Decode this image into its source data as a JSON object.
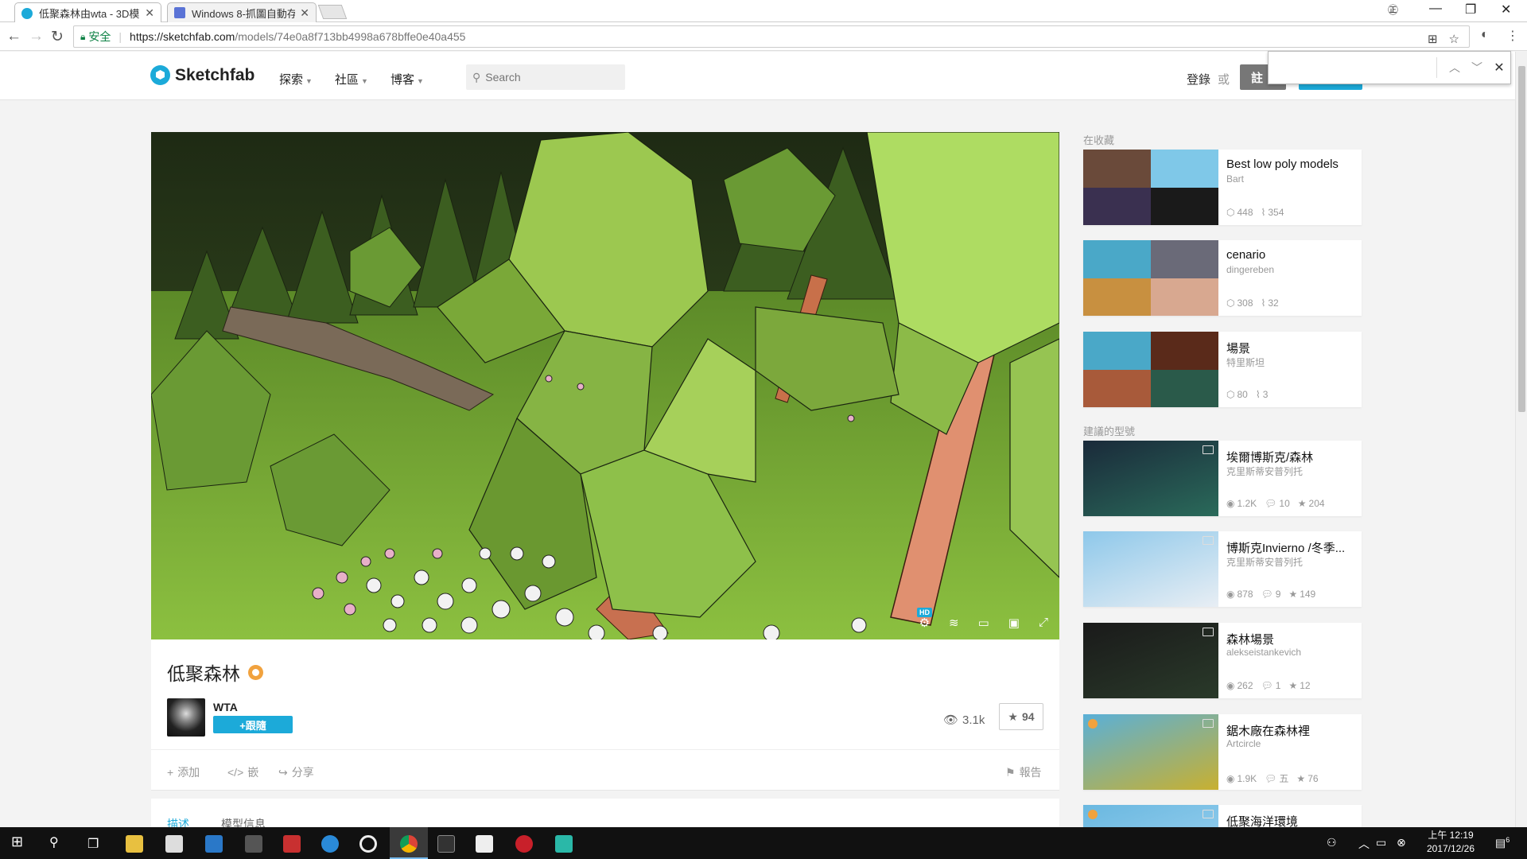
{
  "browser": {
    "tabs": [
      {
        "title": "低聚森林由wta - 3D模型",
        "active": true
      },
      {
        "title": "Windows 8-抓圖自動存",
        "active": false
      }
    ],
    "window_controls": {
      "translate": "㊣",
      "minimize": "—",
      "maximize": "❐",
      "close": "✕"
    },
    "security_label": "安全",
    "url_host": "https://sketchfab.com",
    "url_path": "/models/74e0a8f713bb4998a678bffe0e40a455",
    "find_placeholder": ""
  },
  "site": {
    "logo_text": "Sketchfab",
    "nav": [
      {
        "label": "探索"
      },
      {
        "label": "社區"
      },
      {
        "label": "博客"
      }
    ],
    "search_placeholder": "Search",
    "login_label": "登錄",
    "or_label": "或",
    "signup_label": "註"
  },
  "model": {
    "title": "低聚森林",
    "author": "WTA",
    "follow_label": "+跟隨",
    "views": "3.1k",
    "likes": "94",
    "actions": {
      "add": "添加",
      "embed": "嵌",
      "share": "分享",
      "report": "報告"
    },
    "viewer_hd": "HD",
    "tabs": {
      "description": "描述",
      "model_info": "模型信息"
    }
  },
  "sidebar": {
    "collections_heading": "在收藏",
    "collections": [
      {
        "title": "Best low poly models",
        "author": "Bart",
        "models": "448",
        "followers": "354",
        "colors": [
          "#6a4a3a",
          "#7fc8e8",
          "#3a3050",
          "#1a1a1a"
        ]
      },
      {
        "title": "cenario",
        "author": "dingereben",
        "models": "308",
        "followers": "32",
        "colors": [
          "#4aa8c8",
          "#6a6a78",
          "#c89040",
          "#d8a890"
        ]
      },
      {
        "title": "場景",
        "author": "特里斯坦",
        "models": "80",
        "followers": "3",
        "colors": [
          "#4aa8c8",
          "#5a2a1a",
          "#a85a3a",
          "#2a5a4a"
        ]
      }
    ],
    "recommended_heading": "建議的型號",
    "recommended": [
      {
        "title": "埃爾博斯克/森林",
        "author": "克里斯蒂安普列托",
        "views": "1.2K",
        "comments": "10",
        "likes": "204",
        "colors": [
          "#1a2a3a",
          "#2a6a5a"
        ],
        "staff": false
      },
      {
        "title": "博斯克Invierno /冬季...",
        "author": "克里斯蒂安普列托",
        "views": "878",
        "comments": "9",
        "likes": "149",
        "colors": [
          "#8ec8ea",
          "#e8eef4"
        ],
        "staff": false
      },
      {
        "title": "森林場景",
        "author": "alekseistankevich",
        "views": "262",
        "comments": "1",
        "likes": "12",
        "colors": [
          "#1a1a1a",
          "#2a3a2a"
        ],
        "staff": false
      },
      {
        "title": "鋸木廠在森林裡",
        "author": "Artcircle",
        "views": "1.9K",
        "comments": "五",
        "likes": "76",
        "colors": [
          "#5ab0d8",
          "#c8b030"
        ],
        "staff": true
      },
      {
        "title": "低聚海洋環境",
        "author": "",
        "views": "",
        "comments": "",
        "likes": "",
        "colors": [
          "#6ab8e0",
          "#8ac8ea"
        ],
        "staff": true
      }
    ]
  },
  "taskbar": {
    "clock_time": "上午 12:19",
    "clock_date": "2017/12/26",
    "notification_count": "6"
  },
  "colors": {
    "accent": "#1caad9",
    "staff_badge": "#f1a23e",
    "secure_green": "#0b8043"
  }
}
